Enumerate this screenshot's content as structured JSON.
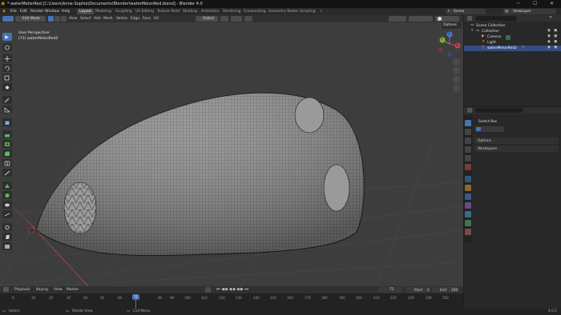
{
  "window": {
    "title": "* waterMelonRed [C:\\Users\\Anne-Sophie\\Documents\\Blender\\waterMelonRed.blend] - Blender 4.0",
    "controls": [
      "─",
      "☐",
      "✕"
    ]
  },
  "menu": {
    "items": [
      "File",
      "Edit",
      "Render",
      "Window",
      "Help"
    ],
    "workspaces": [
      "Layout",
      "Modeling",
      "Sculpting",
      "UV Editing",
      "Texture Paint",
      "Shading",
      "Animation",
      "Rendering",
      "Compositing",
      "Geometry Nodes",
      "Scripting"
    ],
    "add_tab": "+",
    "scene_label": "Scene",
    "viewlayer_label": "ViewLayer"
  },
  "header": {
    "mode": "Edit Mode",
    "menus": [
      "View",
      "Select",
      "Add",
      "Mesh",
      "Vertex",
      "Edge",
      "Face",
      "UV"
    ],
    "orientation": "Global",
    "options": "Options"
  },
  "viewport": {
    "perspective": "User Perspective",
    "object_label": "(71) waterMelonRed2",
    "gizmo": {
      "x": "X",
      "y": "Y",
      "z": "Z"
    },
    "colors": {
      "bg": "#3d3d3d",
      "mesh": "#8f8f8f",
      "seed": "#9a9a9a",
      "x_axis": "#c8454b",
      "y_axis": "#86b03a",
      "z_axis": "#4f7ad9"
    }
  },
  "outliner": {
    "root": "Scene Collection",
    "collection": "Collection",
    "items": [
      "Camera",
      "Light",
      "waterMelonRed2"
    ]
  },
  "properties": {
    "tool_name": "Select Box",
    "sections": [
      "Options",
      "Workspace"
    ]
  },
  "timeline": {
    "menus": [
      "Playback",
      "Keying",
      "View",
      "Marker"
    ],
    "current_frame": "71",
    "start_label": "Start",
    "start": "1",
    "end_label": "End",
    "end": "250",
    "ticks": [
      "0",
      "10",
      "20",
      "30",
      "40",
      "50",
      "60",
      "70",
      "71",
      "80",
      "90",
      "100",
      "110",
      "120",
      "130",
      "140",
      "150",
      "160",
      "170",
      "180",
      "190",
      "200",
      "210",
      "220",
      "230",
      "240",
      "250"
    ],
    "current_frame_fraction": 0.284
  },
  "status": {
    "items": [
      "Select",
      "Rotate View",
      "Call Menu"
    ],
    "version": "4.0.2"
  }
}
